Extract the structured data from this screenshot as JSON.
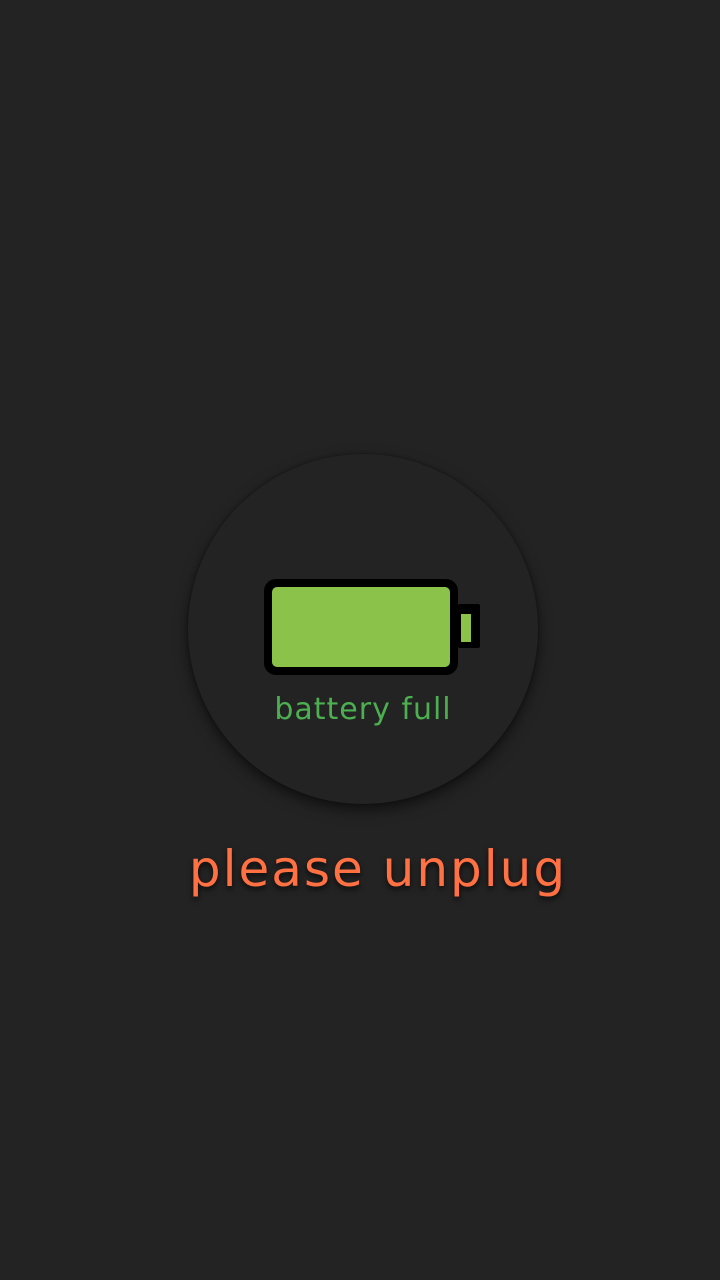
{
  "status": {
    "label": "battery full",
    "level_percent": 100
  },
  "message": {
    "text": "please unplug"
  },
  "colors": {
    "background": "#232323",
    "battery_fill": "#8BC34A",
    "battery_outline": "#000000",
    "status_text": "#4CAF50",
    "message_text": "#FF7043"
  },
  "icons": {
    "battery": "battery-full-icon"
  }
}
